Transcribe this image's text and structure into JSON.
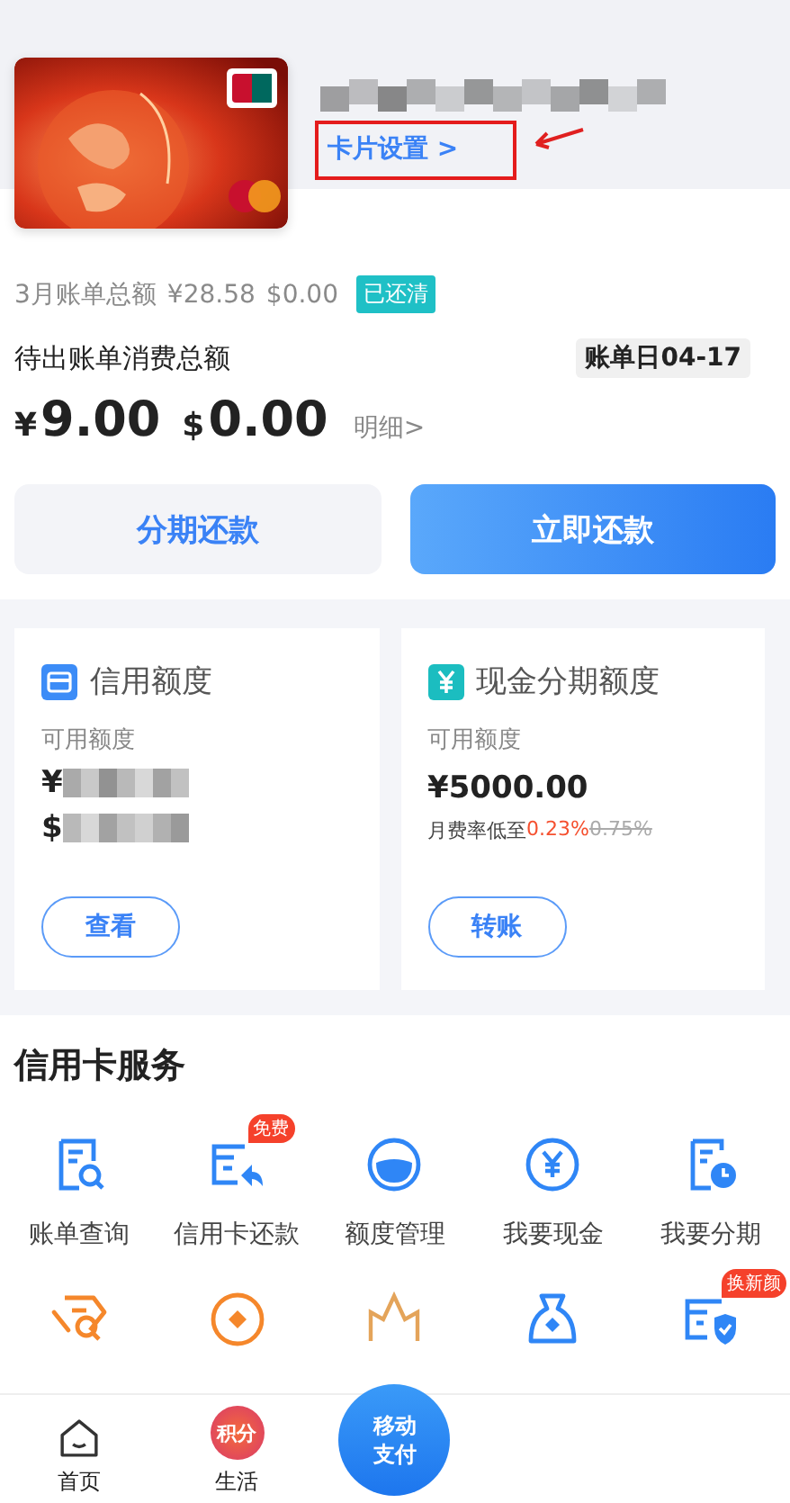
{
  "card": {
    "settings_link": "卡片设置 >"
  },
  "last_bill": {
    "label": "3月账单总额",
    "cny": "¥28.58",
    "usd": "$0.00",
    "status": "已还清"
  },
  "pending": {
    "label": "待出账单消费总额",
    "bill_day": "账单日04-17",
    "cny_symbol": "¥",
    "cny": "9.00",
    "usd_symbol": "$",
    "usd": "0.00",
    "detail": "明细>"
  },
  "actions": [
    {
      "label": "分期还款",
      "kind": "secondary"
    },
    {
      "label": "立即还款",
      "kind": "primary"
    }
  ],
  "limits": [
    {
      "kind": "credit",
      "title": "信用额度",
      "sub": "可用额度",
      "currencies": [
        "¥",
        "$"
      ],
      "button": "查看"
    },
    {
      "kind": "cash",
      "title": "现金分期额度",
      "sub": "可用额度",
      "amount": "¥5000.00",
      "rate_label": "月费率低至",
      "rate": "0.23%",
      "old_rate": "0.75%",
      "button": "转账"
    }
  ],
  "services": {
    "title": "信用卡服务",
    "items": [
      {
        "kind": "bill-search",
        "label": "账单查询"
      },
      {
        "kind": "card-repay",
        "label": "信用卡还款",
        "badge": "免费"
      },
      {
        "kind": "limit",
        "label": "额度管理"
      },
      {
        "kind": "cash",
        "label": "我要现金"
      },
      {
        "kind": "installment",
        "label": "我要分期"
      }
    ],
    "more": [
      {
        "kind": "tag-search"
      },
      {
        "kind": "coin"
      },
      {
        "kind": "crown"
      },
      {
        "kind": "bag"
      },
      {
        "kind": "card-shield",
        "badge": "换新颜"
      }
    ]
  },
  "nav": [
    {
      "kind": "home",
      "label": "首页"
    },
    {
      "kind": "points",
      "label": "生活",
      "badge": "积分"
    },
    {
      "kind": "pay",
      "lines": [
        "移动",
        "支付"
      ]
    }
  ]
}
